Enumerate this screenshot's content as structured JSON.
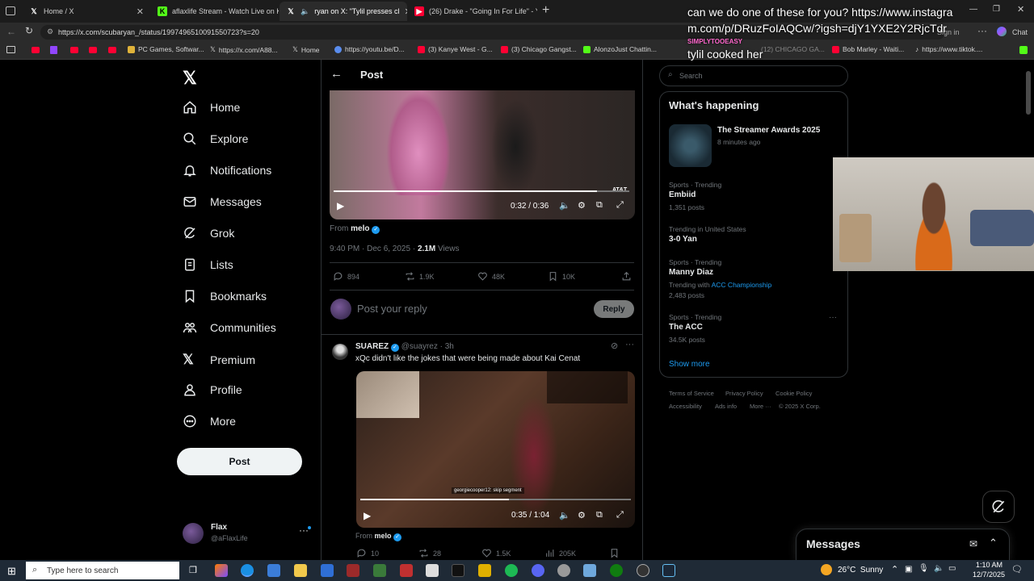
{
  "tabs": [
    {
      "title": "Home / X",
      "icon": "x-logo-icon",
      "color": "#ffffff"
    },
    {
      "title": "aflaxlife Stream - Watch Live on Ki",
      "icon": "kick-icon",
      "color": "#53fc18"
    },
    {
      "title": "ryan     on X: \"Tylil presses cl",
      "icon": "x-logo-icon",
      "color": "#ffffff"
    },
    {
      "title": "(26) Drake - \"Going In For Life\" - Y",
      "icon": "youtube-icon",
      "color": "#ff0033"
    }
  ],
  "address": {
    "url": "https://x.com/scubaryan_/status/1997496510091550723?s=20"
  },
  "bookmarks": [
    {
      "label": "PC Games, Softwar..."
    },
    {
      "label": "https://x.com/A88..."
    },
    {
      "label": "Home"
    },
    {
      "label": "https://youtu.be/D..."
    },
    {
      "label": "(3) Kanye West - G..."
    },
    {
      "label": "(3) Chicago Gangst..."
    },
    {
      "label": "AlonzoJust Chattin..."
    },
    {
      "label": "(12) CHICAGO GA..."
    },
    {
      "label": "Bob Marley - Waiti..."
    },
    {
      "label": "https://www.tiktok...."
    }
  ],
  "browser_right": {
    "sign_in": "Sign in",
    "chat": "Chat"
  },
  "nav": {
    "items": [
      {
        "label": "Home",
        "icon": "home-icon"
      },
      {
        "label": "Explore",
        "icon": "search-icon"
      },
      {
        "label": "Notifications",
        "icon": "bell-icon"
      },
      {
        "label": "Messages",
        "icon": "envelope-icon"
      },
      {
        "label": "Grok",
        "icon": "grok-icon"
      },
      {
        "label": "Lists",
        "icon": "list-icon"
      },
      {
        "label": "Bookmarks",
        "icon": "bookmark-icon"
      },
      {
        "label": "Communities",
        "icon": "people-icon"
      },
      {
        "label": "Premium",
        "icon": "x-logo-icon"
      },
      {
        "label": "Profile",
        "icon": "person-icon"
      },
      {
        "label": "More",
        "icon": "more-circle-icon"
      }
    ],
    "post_button": "Post",
    "account": {
      "name": "Flax",
      "handle": "@aFlaxLife"
    }
  },
  "post": {
    "header": "Post",
    "video1": {
      "time": "0:32 / 0:36",
      "watermark": "AT&T",
      "progress": 0.89
    },
    "from_label": "From",
    "from_user": "melo",
    "timestamp": "9:40 PM · Dec 6, 2025 ·",
    "views_count": "2.1M",
    "views_label": "Views",
    "stats": {
      "replies": "894",
      "reposts": "1.9K",
      "likes": "48K",
      "bookmarks": "10K"
    },
    "reply_placeholder": "Post your reply",
    "reply_button": "Reply"
  },
  "reply": {
    "name": "SUAREZ",
    "handle": "@suayrez",
    "time": "· 3h",
    "text": "xQc didn't like the jokes that were being made about Kai Cenat",
    "video2": {
      "time": "0:35 / 1:04",
      "caption": "georgiecooper12: skip segment",
      "progress": 0.55
    },
    "from_label": "From",
    "from_user": "melo",
    "stats": {
      "replies": "10",
      "reposts": "28",
      "likes": "1.5K",
      "views": "205K"
    }
  },
  "sidebar": {
    "search_placeholder": "Search",
    "heading": "What's happening",
    "event": {
      "title": "The Streamer Awards 2025",
      "time": "8 minutes ago"
    },
    "trends": [
      {
        "category": "Sports · Trending",
        "name": "Embiid",
        "posts": "1,351 posts"
      },
      {
        "category": "Trending in United States",
        "name": "3-0 Yan",
        "posts": ""
      },
      {
        "category": "Sports · Trending",
        "name": "Manny Diaz",
        "extra_prefix": "Trending with",
        "extra_link": "ACC Championship",
        "posts": "2,483 posts"
      },
      {
        "category": "Sports · Trending",
        "name": "The ACC",
        "posts": "34.5K posts"
      }
    ],
    "show_more": "Show more",
    "footer": [
      "Terms of Service",
      "Privacy Policy",
      "Cookie Policy",
      "Accessibility",
      "Ads info",
      "More ···",
      "© 2025 X Corp."
    ]
  },
  "chat_overlay": {
    "message_1": "can we do one of these for you? https://www.instagram.com/p/DRuzFoIAQCw/?igsh=djY1YXE2Y2RjcTdr",
    "user_2": "SIMPLYTOOEASY",
    "message_2": "tylil cooked her"
  },
  "messages_drawer": {
    "title": "Messages"
  },
  "taskbar": {
    "search_placeholder": "Type here to search",
    "weather": "26°C  Sunny",
    "time": "1:10 AM",
    "date": "12/7/2025"
  }
}
